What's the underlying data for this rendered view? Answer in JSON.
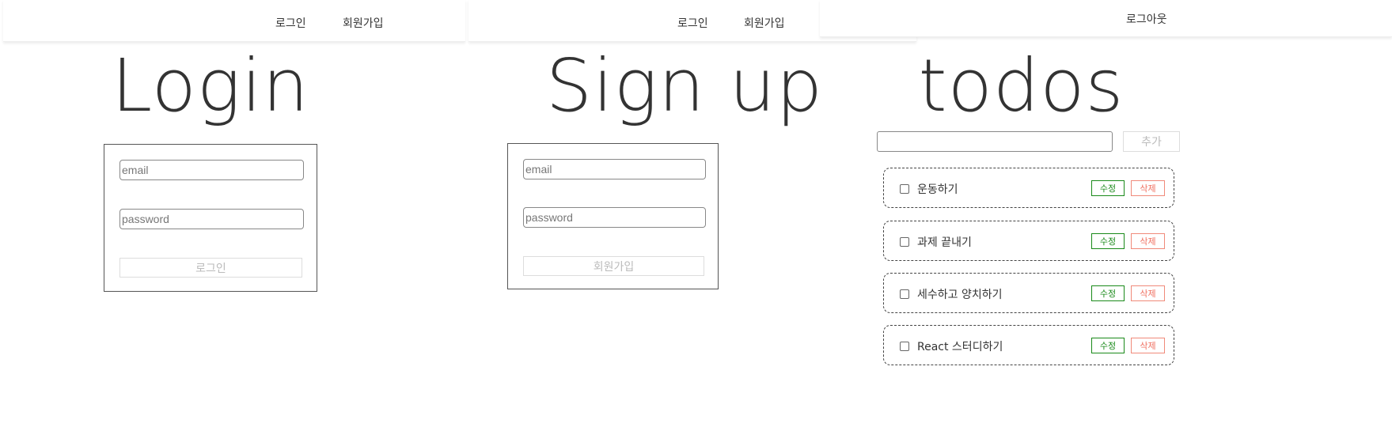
{
  "login_page": {
    "nav": {
      "login": "로그인",
      "signup": "회원가입"
    },
    "title": "Login",
    "form": {
      "email_placeholder": "email",
      "password_placeholder": "password",
      "submit_label": "로그인"
    }
  },
  "signup_page": {
    "nav": {
      "login": "로그인",
      "signup": "회원가입"
    },
    "title": "Sign up",
    "form": {
      "email_placeholder": "email",
      "password_placeholder": "password",
      "submit_label": "회원가입"
    }
  },
  "todo_page": {
    "nav": {
      "logout": "로그아웃"
    },
    "title": "todos",
    "new_todo": {
      "value": "",
      "add_label": "추가"
    },
    "items": [
      {
        "text": "운동하기",
        "checked": false,
        "edit_label": "수정",
        "delete_label": "삭제"
      },
      {
        "text": "과제 끝내기",
        "checked": false,
        "edit_label": "수정",
        "delete_label": "삭제"
      },
      {
        "text": "세수하고 양치하기",
        "checked": false,
        "edit_label": "수정",
        "delete_label": "삭제"
      },
      {
        "text": "React 스터디하기",
        "checked": false,
        "edit_label": "수정",
        "delete_label": "삭제"
      }
    ],
    "colors": {
      "edit": "#1a8a1a",
      "delete": "#f07060"
    }
  }
}
